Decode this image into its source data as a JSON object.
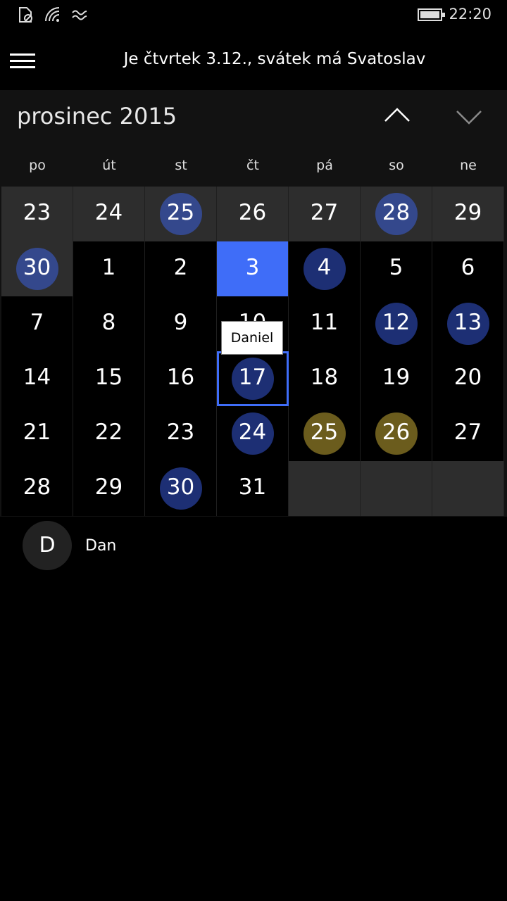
{
  "status": {
    "time": "22:20",
    "icons": [
      "battery-saver-icon",
      "wifi-icon",
      "vibrate-icon",
      "battery-icon"
    ]
  },
  "header": {
    "title": "Je čtvrtek 3.12., svátek má Svatoslav"
  },
  "calendar": {
    "month_label": "prosinec 2015",
    "weekdays": [
      "po",
      "út",
      "st",
      "čt",
      "pá",
      "so",
      "ne"
    ],
    "weeks": [
      [
        {
          "d": "23",
          "other": true
        },
        {
          "d": "24",
          "other": true
        },
        {
          "d": "25",
          "other": true,
          "mark": "blue-light"
        },
        {
          "d": "26",
          "other": true
        },
        {
          "d": "27",
          "other": true
        },
        {
          "d": "28",
          "other": true,
          "mark": "blue-light"
        },
        {
          "d": "29",
          "other": true
        }
      ],
      [
        {
          "d": "30",
          "other": true,
          "mark": "blue-light"
        },
        {
          "d": "1"
        },
        {
          "d": "2"
        },
        {
          "d": "3",
          "today": true
        },
        {
          "d": "4",
          "mark": "blue"
        },
        {
          "d": "5"
        },
        {
          "d": "6"
        }
      ],
      [
        {
          "d": "7"
        },
        {
          "d": "8"
        },
        {
          "d": "9"
        },
        {
          "d": "10"
        },
        {
          "d": "11"
        },
        {
          "d": "12",
          "mark": "blue"
        },
        {
          "d": "13",
          "mark": "blue"
        }
      ],
      [
        {
          "d": "14"
        },
        {
          "d": "15"
        },
        {
          "d": "16"
        },
        {
          "d": "17",
          "mark": "blue",
          "selected": true
        },
        {
          "d": "18"
        },
        {
          "d": "19"
        },
        {
          "d": "20"
        }
      ],
      [
        {
          "d": "21"
        },
        {
          "d": "22"
        },
        {
          "d": "23"
        },
        {
          "d": "24",
          "mark": "blue"
        },
        {
          "d": "25",
          "mark": "gold"
        },
        {
          "d": "26",
          "mark": "gold"
        },
        {
          "d": "27"
        }
      ],
      [
        {
          "d": "28"
        },
        {
          "d": "29"
        },
        {
          "d": "30",
          "mark": "blue"
        },
        {
          "d": "31"
        },
        {
          "empty": true
        },
        {
          "empty": true
        },
        {
          "empty": true
        }
      ]
    ],
    "tooltip": "Daniel"
  },
  "agenda": {
    "items": [
      {
        "initial": "D",
        "name": "Dan"
      }
    ]
  },
  "colors": {
    "accent": "#3f6df8",
    "event_blue": "#1d2f74",
    "holiday_gold": "#6b5c1d"
  }
}
